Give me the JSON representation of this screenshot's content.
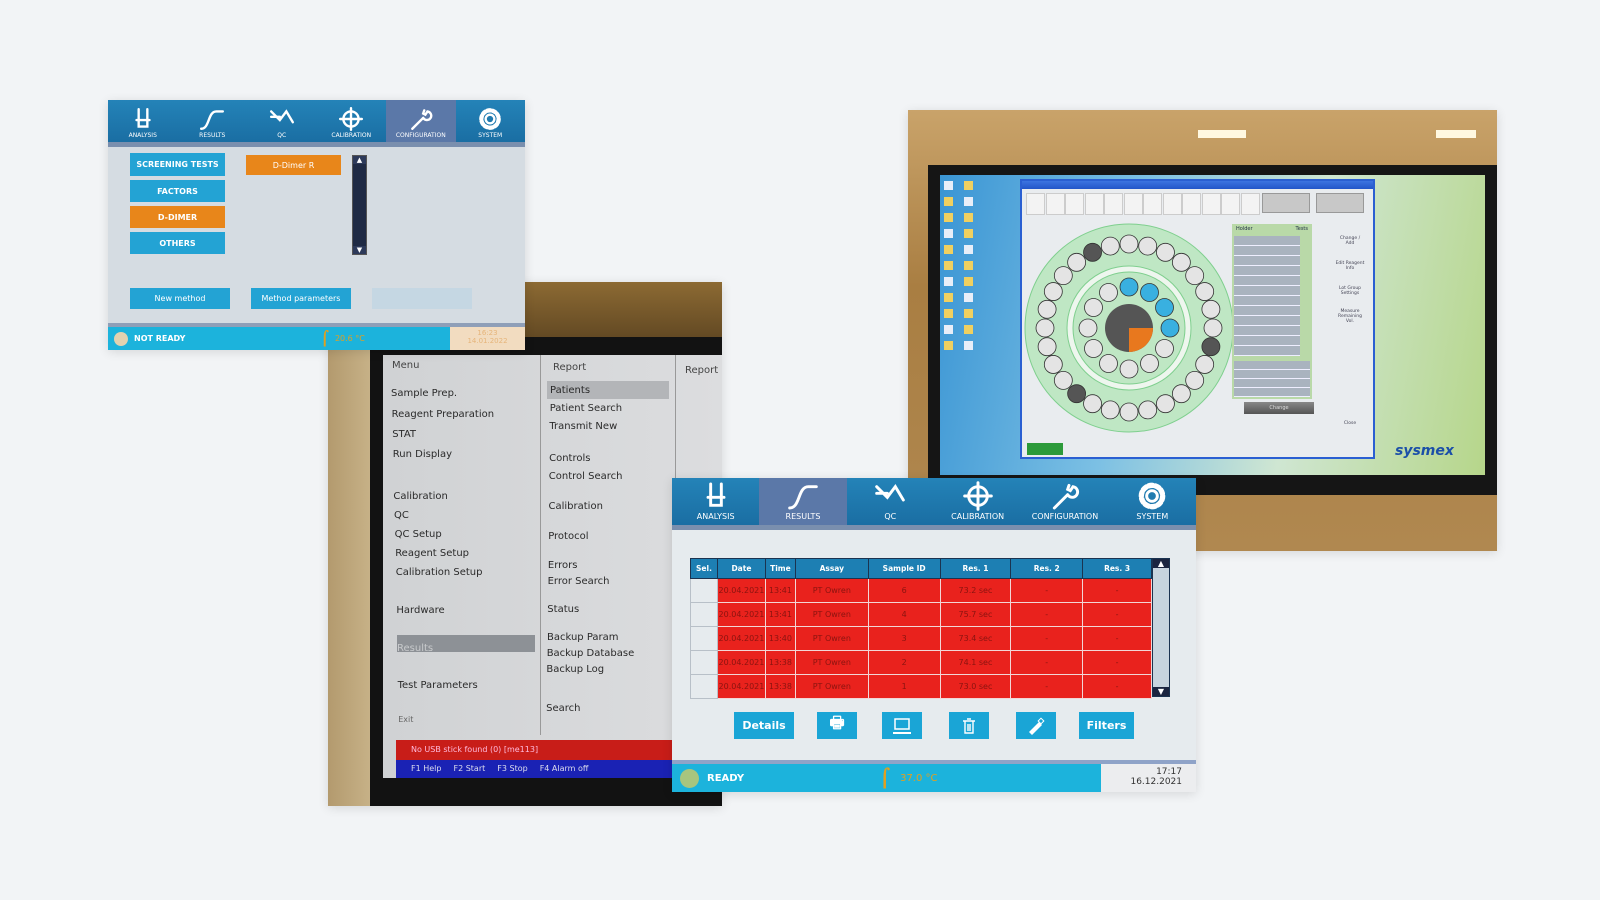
{
  "panel_config": {
    "nav": [
      "ANALYSIS",
      "RESULTS",
      "QC",
      "CALIBRATION",
      "CONFIGURATION",
      "SYSTEM"
    ],
    "selected_tab": "CONFIGURATION",
    "categories": [
      "SCREENING TESTS",
      "FACTORS",
      "D-DIMER",
      "OTHERS"
    ],
    "selected_category": "D-DIMER",
    "methods": [
      "D-Dimer R"
    ],
    "new_method": "New method",
    "method_parameters": "Method parameters",
    "status": "NOT READY",
    "temperature": "20.6 °C",
    "time": "16:23",
    "date": "14.01.2022"
  },
  "panel_menu": {
    "menu_header": "Menu",
    "menu_items": [
      "Sample Prep.",
      "Reagent Preparation",
      "STAT",
      "Run Display",
      "Calibration",
      "QC",
      "QC Setup",
      "Reagent Setup",
      "Calibration Setup",
      "Hardware",
      "Results",
      "Test Parameters",
      "Exit"
    ],
    "selected_menu": "Results",
    "report_header": "Report",
    "report_items": [
      "Patients",
      "Patient Search",
      "Transmit New",
      "Controls",
      "Control Search",
      "Calibration",
      "Protocol",
      "Errors",
      "Error Search",
      "Status",
      "Backup Param",
      "Backup Database",
      "Backup Log",
      "Search"
    ],
    "selected_report": "Patients",
    "report_header_2": "Report",
    "error": "No USB stick found (0)  [me113]",
    "fkeys": [
      "F1 Help",
      "F2 Start",
      "F3 Stop",
      "F4 Alarm off"
    ]
  },
  "panel_results": {
    "nav": [
      "ANALYSIS",
      "RESULTS",
      "QC",
      "CALIBRATION",
      "CONFIGURATION",
      "SYSTEM"
    ],
    "selected_tab": "RESULTS",
    "columns": [
      "Sel.",
      "Date",
      "Time",
      "Assay",
      "Sample ID",
      "Res. 1",
      "Res. 2",
      "Res. 3"
    ],
    "rows": [
      [
        "",
        "20.04.2021",
        "13:41",
        "PT Owren",
        "6",
        "73.2 sec",
        "-",
        "-"
      ],
      [
        "",
        "20.04.2021",
        "13:41",
        "PT Owren",
        "4",
        "75.7 sec",
        "-",
        "-"
      ],
      [
        "",
        "20.04.2021",
        "13:40",
        "PT Owren",
        "3",
        "73.4 sec",
        "-",
        "-"
      ],
      [
        "",
        "20.04.2021",
        "13:38",
        "PT Owren",
        "2",
        "74.1 sec",
        "-",
        "-"
      ],
      [
        "",
        "20.04.2021",
        "13:38",
        "PT Owren",
        "1",
        "73.0 sec",
        "-",
        "-"
      ]
    ],
    "details": "Details",
    "filters": "Filters",
    "status": "READY",
    "temperature": "37.0 °C",
    "time": "17:17",
    "date": "16.12.2021",
    "row_color": "#e9221d",
    "accent": "#1aa5d6"
  },
  "panel_sysmex": {
    "holder": "Holder",
    "tests": "Tests",
    "change": "Change",
    "side_buttons": [
      "Change / Add",
      "Edit Reagent Info",
      "Lot Group Settings",
      "Measure Remaining Vol.",
      "Close"
    ],
    "logo": "sysmex"
  }
}
